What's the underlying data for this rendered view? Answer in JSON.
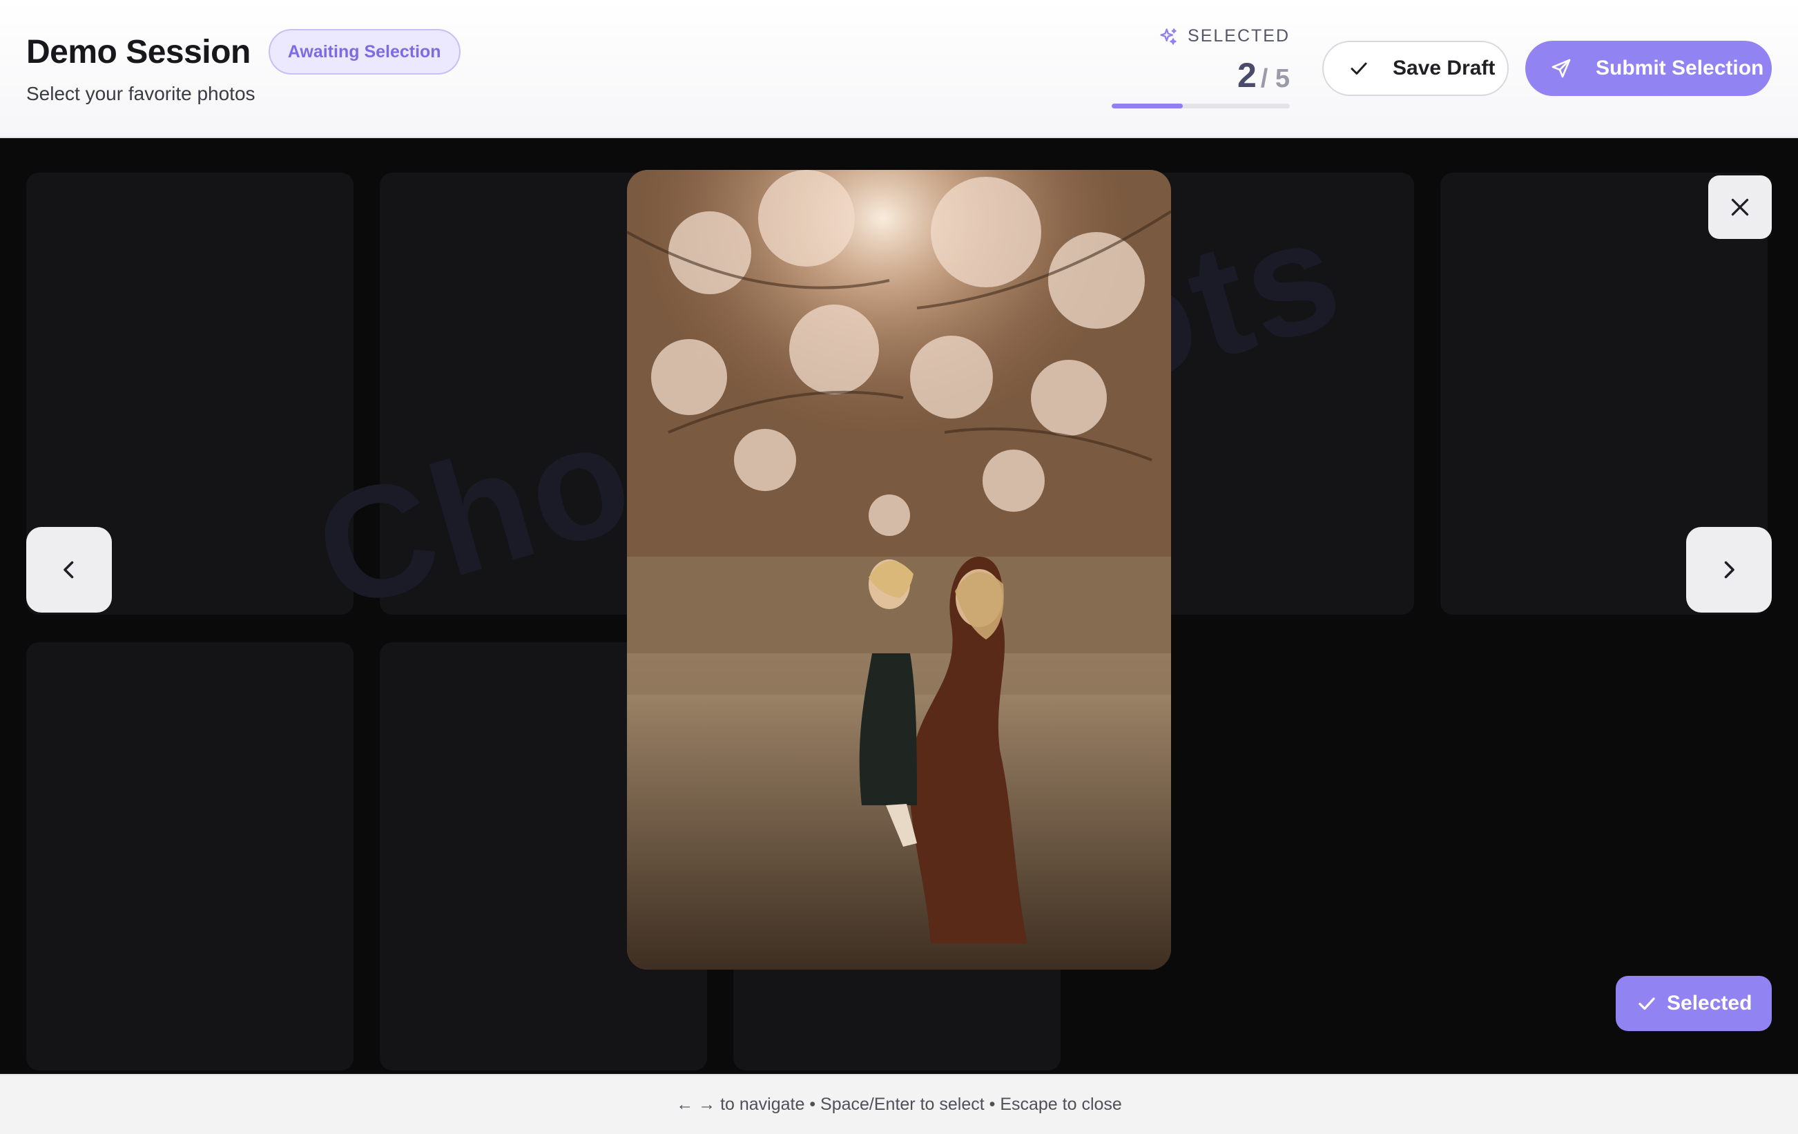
{
  "header": {
    "title": "Demo Session",
    "status_badge": "Awaiting Selection",
    "subtitle": "Select your favorite photos",
    "selection": {
      "label": "SELECTED",
      "count": "2",
      "total": "/ 5",
      "progress_fraction": 0.4
    },
    "save_draft_label": "Save Draft",
    "submit_label": "Submit Selection"
  },
  "lightbox": {
    "watermark": "ChooseShots",
    "selected_label": "Selected"
  },
  "footer": {
    "hint": "← → to navigate • Space/Enter to select • Escape to close"
  },
  "colors": {
    "accent": "#9283f3",
    "badge_bg": "#ece8fd",
    "badge_text": "#7d6be6"
  },
  "icons": {
    "selected_label": "sparkle-icon",
    "save_draft": "check-icon",
    "submit": "send-icon",
    "close": "close-icon",
    "prev": "chevron-left-icon",
    "next": "chevron-right-icon"
  }
}
